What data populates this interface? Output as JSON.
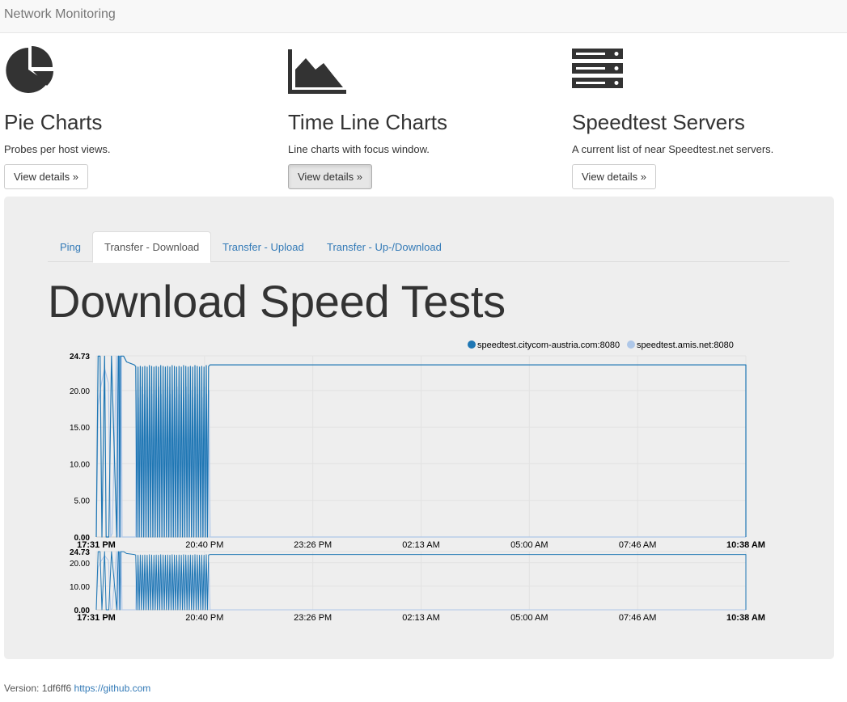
{
  "nav": {
    "brand": "Network Monitoring"
  },
  "features": [
    {
      "title": "Pie Charts",
      "description": "Probes per host views.",
      "button": "View details »",
      "icon": "pie-chart-icon"
    },
    {
      "title": "Time Line Charts",
      "description": "Line charts with focus window.",
      "button": "View details »",
      "icon": "area-chart-icon"
    },
    {
      "title": "Speedtest Servers",
      "description": "A current list of near Speedtest.net servers.",
      "button": "View details »",
      "icon": "server-icon"
    }
  ],
  "tabs": [
    "Ping",
    "Transfer - Download",
    "Transfer - Upload",
    "Transfer - Up-/Download"
  ],
  "active_tab": "Transfer - Download",
  "heading": "Download Speed Tests",
  "chart_data": [
    {
      "type": "line",
      "title": "",
      "legend_position": "top-right",
      "x_ticks": [
        "17:31 PM",
        "20:40 PM",
        "23:26 PM",
        "02:13 AM",
        "05:00 AM",
        "07:46 AM",
        "10:38 AM"
      ],
      "x_ticks_bold": [
        "17:31 PM",
        "10:38 AM"
      ],
      "y_ticks": [
        "24.73",
        "20.00",
        "15.00",
        "10.00",
        "5.00",
        "0.00"
      ],
      "ylim": [
        0,
        24.73
      ],
      "grid": true,
      "series": [
        {
          "name": "speedtest.citycom-austria.com:8080",
          "color": "#1f77b4",
          "points": [
            [
              0.0,
              0.0
            ],
            [
              0.05,
              24.7
            ],
            [
              0.1,
              24.7
            ],
            [
              0.15,
              0.0
            ],
            [
              0.22,
              24.7
            ],
            [
              0.26,
              0.0
            ],
            [
              0.33,
              0.0
            ],
            [
              0.4,
              24.7
            ],
            [
              0.54,
              0.0
            ],
            [
              0.58,
              24.7
            ],
            [
              0.6,
              24.7
            ],
            [
              0.62,
              0.0
            ],
            [
              0.64,
              24.7
            ],
            [
              0.66,
              24.7
            ],
            [
              0.72,
              24.7
            ],
            [
              0.8,
              23.9
            ],
            [
              1.0,
              23.5
            ],
            [
              1.04,
              23.3
            ],
            [
              1.07,
              0.0
            ],
            [
              1.1,
              23.2
            ],
            [
              1.13,
              0.0
            ],
            [
              1.16,
              23.3
            ],
            [
              1.19,
              0.0
            ],
            [
              1.22,
              23.2
            ],
            [
              1.25,
              0.0
            ],
            [
              1.28,
              23.3
            ],
            [
              1.31,
              0.0
            ],
            [
              1.34,
              23.2
            ],
            [
              1.37,
              0.0
            ],
            [
              1.4,
              23.4
            ],
            [
              1.43,
              0.0
            ],
            [
              1.46,
              23.3
            ],
            [
              1.49,
              0.0
            ],
            [
              1.52,
              23.2
            ],
            [
              1.55,
              0.0
            ],
            [
              1.58,
              23.3
            ],
            [
              1.61,
              0.0
            ],
            [
              1.64,
              23.2
            ],
            [
              1.67,
              0.0
            ],
            [
              1.7,
              23.4
            ],
            [
              1.73,
              0.0
            ],
            [
              1.76,
              23.3
            ],
            [
              1.79,
              0.0
            ],
            [
              1.82,
              23.2
            ],
            [
              1.85,
              0.0
            ],
            [
              1.88,
              23.3
            ],
            [
              1.91,
              0.0
            ],
            [
              1.94,
              23.2
            ],
            [
              1.97,
              0.0
            ],
            [
              2.0,
              23.4
            ],
            [
              2.03,
              0.0
            ],
            [
              2.06,
              23.3
            ],
            [
              2.09,
              0.0
            ],
            [
              2.12,
              23.2
            ],
            [
              2.15,
              0.0
            ],
            [
              2.18,
              23.3
            ],
            [
              2.21,
              0.0
            ],
            [
              2.24,
              23.2
            ],
            [
              2.27,
              0.0
            ],
            [
              2.3,
              23.4
            ],
            [
              2.33,
              0.0
            ],
            [
              2.36,
              23.3
            ],
            [
              2.39,
              0.0
            ],
            [
              2.42,
              23.2
            ],
            [
              2.45,
              0.0
            ],
            [
              2.48,
              23.3
            ],
            [
              2.51,
              0.0
            ],
            [
              2.54,
              23.2
            ],
            [
              2.57,
              0.0
            ],
            [
              2.6,
              23.4
            ],
            [
              2.63,
              0.0
            ],
            [
              2.66,
              23.3
            ],
            [
              2.69,
              0.0
            ],
            [
              2.72,
              23.2
            ],
            [
              2.75,
              0.0
            ],
            [
              2.78,
              23.3
            ],
            [
              2.81,
              0.0
            ],
            [
              2.84,
              23.2
            ],
            [
              2.87,
              0.0
            ],
            [
              2.9,
              23.4
            ],
            [
              2.93,
              0.0
            ],
            [
              2.96,
              23.3
            ],
            [
              3.0,
              23.5
            ],
            [
              6.0,
              23.5
            ],
            [
              10.5,
              23.5
            ],
            [
              17.12,
              23.5
            ],
            [
              17.12,
              0.0
            ]
          ]
        },
        {
          "name": "speedtest.amis.net:8080",
          "color": "#aec7e8",
          "points": [
            [
              0.0,
              0.0
            ],
            [
              0.05,
              18.0
            ],
            [
              0.12,
              20.5
            ],
            [
              0.22,
              23.0
            ],
            [
              0.32,
              21.0
            ],
            [
              0.38,
              0.0
            ],
            [
              0.42,
              0.5
            ],
            [
              0.48,
              13.0
            ],
            [
              0.53,
              24.7
            ],
            [
              0.56,
              0.0
            ],
            [
              0.58,
              24.7
            ],
            [
              0.6,
              0.0
            ],
            [
              0.62,
              24.7
            ],
            [
              0.64,
              0.0
            ],
            [
              0.66,
              24.7
            ],
            [
              0.68,
              0.0
            ],
            [
              1.04,
              0.0
            ],
            [
              1.05,
              20.0
            ],
            [
              1.08,
              0.0
            ],
            [
              1.11,
              19.0
            ],
            [
              1.14,
              0.0
            ],
            [
              1.17,
              20.5
            ],
            [
              1.2,
              0.0
            ],
            [
              1.23,
              19.5
            ],
            [
              1.26,
              0.0
            ],
            [
              1.29,
              20.0
            ],
            [
              1.32,
              0.0
            ],
            [
              1.35,
              19.0
            ],
            [
              1.38,
              0.0
            ],
            [
              1.41,
              20.5
            ],
            [
              1.44,
              0.0
            ],
            [
              1.47,
              19.5
            ],
            [
              1.5,
              0.0
            ],
            [
              1.53,
              20.0
            ],
            [
              1.56,
              0.0
            ],
            [
              1.59,
              19.0
            ],
            [
              1.62,
              0.0
            ],
            [
              1.65,
              20.5
            ],
            [
              1.68,
              0.0
            ],
            [
              1.71,
              19.5
            ],
            [
              1.74,
              0.0
            ],
            [
              1.77,
              20.0
            ],
            [
              1.8,
              0.0
            ],
            [
              1.83,
              19.0
            ],
            [
              1.86,
              0.0
            ],
            [
              1.89,
              20.5
            ],
            [
              1.92,
              0.0
            ],
            [
              1.95,
              19.5
            ],
            [
              1.98,
              0.0
            ],
            [
              2.01,
              20.0
            ],
            [
              2.04,
              0.0
            ],
            [
              2.07,
              19.0
            ],
            [
              2.1,
              0.0
            ],
            [
              2.13,
              20.5
            ],
            [
              2.16,
              0.0
            ],
            [
              2.19,
              19.5
            ],
            [
              2.22,
              0.0
            ],
            [
              2.25,
              20.0
            ],
            [
              2.28,
              0.0
            ],
            [
              2.31,
              19.0
            ],
            [
              2.34,
              0.0
            ],
            [
              2.37,
              20.5
            ],
            [
              2.4,
              0.0
            ],
            [
              2.43,
              19.5
            ],
            [
              2.46,
              0.0
            ],
            [
              2.49,
              20.0
            ],
            [
              2.52,
              0.0
            ],
            [
              2.55,
              19.0
            ],
            [
              2.58,
              0.0
            ],
            [
              2.61,
              20.5
            ],
            [
              2.64,
              0.0
            ],
            [
              2.67,
              19.5
            ],
            [
              2.7,
              0.0
            ],
            [
              2.73,
              20.0
            ],
            [
              2.76,
              0.0
            ],
            [
              2.79,
              19.0
            ],
            [
              2.82,
              0.0
            ],
            [
              2.85,
              20.5
            ],
            [
              2.88,
              0.0
            ],
            [
              2.91,
              19.5
            ],
            [
              2.94,
              0.0
            ],
            [
              2.97,
              20.0
            ],
            [
              3.0,
              0.0
            ],
            [
              17.12,
              0.0
            ]
          ]
        }
      ],
      "x_unit": "hours since 17:31 PM"
    },
    {
      "type": "line",
      "title": "",
      "role": "focus-window",
      "x_ticks": [
        "17:31 PM",
        "20:40 PM",
        "23:26 PM",
        "02:13 AM",
        "05:00 AM",
        "07:46 AM",
        "10:38 AM"
      ],
      "x_ticks_bold": [
        "17:31 PM",
        "10:38 AM"
      ],
      "y_ticks": [
        "24.73",
        "20.00",
        "10.00",
        "0.00"
      ],
      "ylim": [
        0,
        24.73
      ],
      "series_ref": "same as overview series"
    }
  ],
  "footer": {
    "version_text": "Version: 1df6ff6",
    "link_text": "https://github.com"
  }
}
